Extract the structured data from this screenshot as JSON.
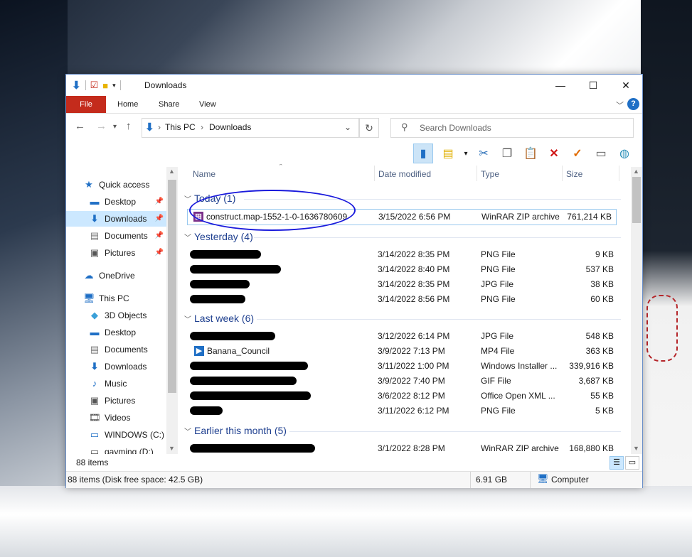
{
  "window": {
    "title": "Downloads",
    "controls": {
      "minimize": "—",
      "maximize": "☐",
      "close": "✕"
    }
  },
  "ribbon": {
    "tabs": [
      "File",
      "Home",
      "Share",
      "View"
    ],
    "help": "?"
  },
  "address": {
    "crumbs": [
      "This PC",
      "Downloads"
    ]
  },
  "search": {
    "placeholder": "Search Downloads"
  },
  "sidebar": {
    "items": [
      {
        "label": "Quick access",
        "icon": "star-icon"
      },
      {
        "label": "Desktop",
        "icon": "desktop-icon",
        "pinned": true
      },
      {
        "label": "Downloads",
        "icon": "download-icon",
        "pinned": true,
        "selected": true
      },
      {
        "label": "Documents",
        "icon": "document-icon",
        "pinned": true
      },
      {
        "label": "Pictures",
        "icon": "pictures-icon",
        "pinned": true
      },
      {
        "label": "OneDrive",
        "icon": "cloud-icon"
      },
      {
        "label": "This PC",
        "icon": "computer-icon"
      },
      {
        "label": "3D Objects",
        "icon": "cube-icon"
      },
      {
        "label": "Desktop",
        "icon": "desktop-icon"
      },
      {
        "label": "Documents",
        "icon": "document-icon"
      },
      {
        "label": "Downloads",
        "icon": "download-icon"
      },
      {
        "label": "Music",
        "icon": "music-icon"
      },
      {
        "label": "Pictures",
        "icon": "pictures-icon"
      },
      {
        "label": "Videos",
        "icon": "video-icon"
      },
      {
        "label": "WINDOWS (C:)",
        "icon": "drive-icon"
      },
      {
        "label": "gayming (D:)",
        "icon": "drive-icon"
      }
    ]
  },
  "columns": {
    "name": "Name",
    "date": "Date modified",
    "type": "Type",
    "size": "Size"
  },
  "groups": [
    {
      "label": "Today (1)",
      "rows": [
        {
          "name": "construct.map-1552-1-0-1636780609",
          "date": "3/15/2022 6:56 PM",
          "type": "WinRAR ZIP archive",
          "size": "761,214 KB",
          "icon": "zip-icon",
          "selected": true
        }
      ]
    },
    {
      "label": "Yesterday (4)",
      "rows": [
        {
          "name": "",
          "date": "3/14/2022 8:35 PM",
          "type": "PNG File",
          "size": "9 KB",
          "icon": "image-icon"
        },
        {
          "name": "",
          "date": "3/14/2022 8:40 PM",
          "type": "PNG File",
          "size": "537 KB",
          "icon": "image-icon"
        },
        {
          "name": "",
          "date": "3/14/2022 8:35 PM",
          "type": "JPG File",
          "size": "38 KB",
          "icon": "image-icon"
        },
        {
          "name": "",
          "date": "3/14/2022 8:56 PM",
          "type": "PNG File",
          "size": "60 KB",
          "icon": "image-icon"
        }
      ]
    },
    {
      "label": "Last week (6)",
      "rows": [
        {
          "name": "",
          "date": "3/12/2022 6:14 PM",
          "type": "JPG File",
          "size": "548 KB",
          "icon": "image-icon"
        },
        {
          "name": "Banana_Council",
          "date": "3/9/2022 7:13 PM",
          "type": "MP4 File",
          "size": "363 KB",
          "icon": "video-icon"
        },
        {
          "name": "",
          "date": "3/11/2022 1:00 PM",
          "type": "Windows Installer ...",
          "size": "339,916 KB",
          "icon": "installer-icon"
        },
        {
          "name": "",
          "date": "3/9/2022 7:40 PM",
          "type": "GIF File",
          "size": "3,687 KB",
          "icon": "image-icon"
        },
        {
          "name": "",
          "date": "3/6/2022 8:12 PM",
          "type": "Office Open XML ...",
          "size": "55 KB",
          "icon": "document-icon"
        },
        {
          "name": "",
          "date": "3/11/2022 6:12 PM",
          "type": "PNG File",
          "size": "5 KB",
          "icon": "image-icon"
        }
      ]
    },
    {
      "label": "Earlier this month (5)",
      "rows": [
        {
          "name": "",
          "date": "3/1/2022 8:28 PM",
          "type": "WinRAR ZIP archive",
          "size": "168,880 KB",
          "icon": "zip-icon"
        }
      ]
    }
  ],
  "status": {
    "items_count": "88 items"
  },
  "details_bar": {
    "summary": "88 items (Disk free space: 42.5 GB)",
    "size": "6.91 GB",
    "location": "Computer"
  },
  "colors": {
    "accent": "#1f6fc5",
    "file_tab": "#c42b1c",
    "selection": "#cce8ff",
    "group_header": "#1e3f8f",
    "annotation_circle": "#1a1adc"
  }
}
